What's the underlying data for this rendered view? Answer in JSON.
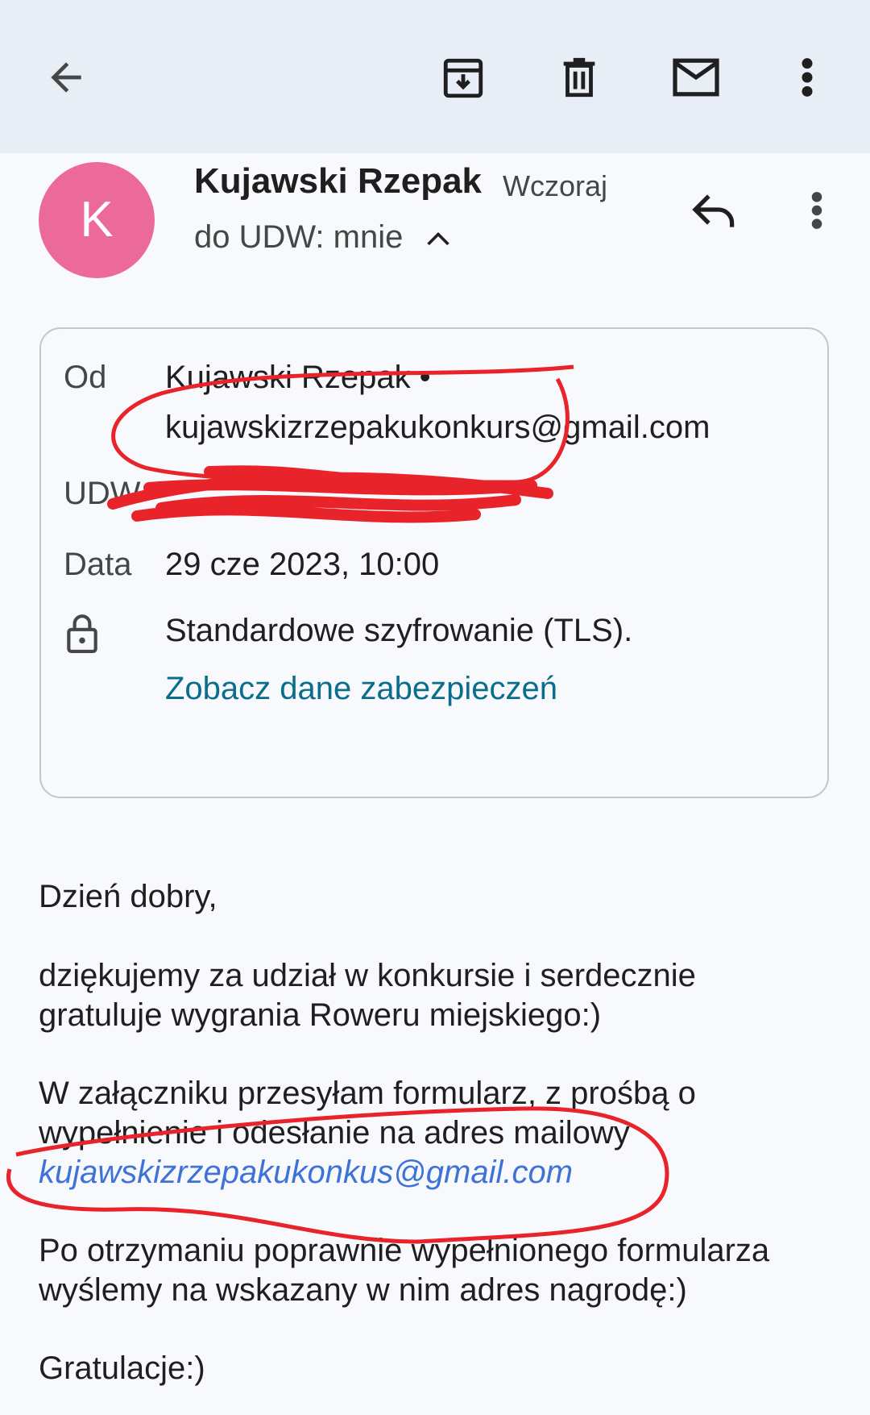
{
  "toolbar": {
    "icons": [
      "back-arrow-icon",
      "archive-icon",
      "delete-icon",
      "mark-unread-icon",
      "more-vert-icon"
    ]
  },
  "message": {
    "avatar_letter": "K",
    "avatar_color": "#eb6a99",
    "sender_name": "Kujawski Rzepak",
    "time": "Wczoraj",
    "recipients": "do UDW: mnie"
  },
  "details": {
    "from_label": "Od",
    "from_name": "Kujawski Rzepak •",
    "from_email": "kujawskizrzepakukonkurs@gmail.com",
    "bcc_label": "UDW",
    "bcc_value": "",
    "date_label": "Data",
    "date_value": "29 cze 2023, 10:00",
    "security_text": "Standardowe szyfrowanie (TLS).",
    "security_link": "Zobacz dane zabezpieczeń"
  },
  "body": {
    "greeting": "Dzień dobry,",
    "p1_line1": "dziękujemy za udział w konkursie i serdecznie",
    "p1_line2": "gratuluje wygrania Roweru miejskiego:)",
    "p2_line1": "W załączniku przesyłam formularz, z prośbą o",
    "p2_line2": "wypełnienie i odesłanie na adres mailowy",
    "p2_link": "kujawskizrzepakukonkus@gmail.com",
    "p3_line1": "Po otrzymaniu poprawnie wypełnionego formularza",
    "p3_line2": "wyślemy na wskazany w nim adres nagrodę:)",
    "closing": "Gratulacje:)"
  },
  "colors": {
    "toolbar_bg": "#e8eef5",
    "annotation_red": "#e8232a",
    "link_teal": "#0b6d8c",
    "link_blue": "#3d72d7"
  }
}
